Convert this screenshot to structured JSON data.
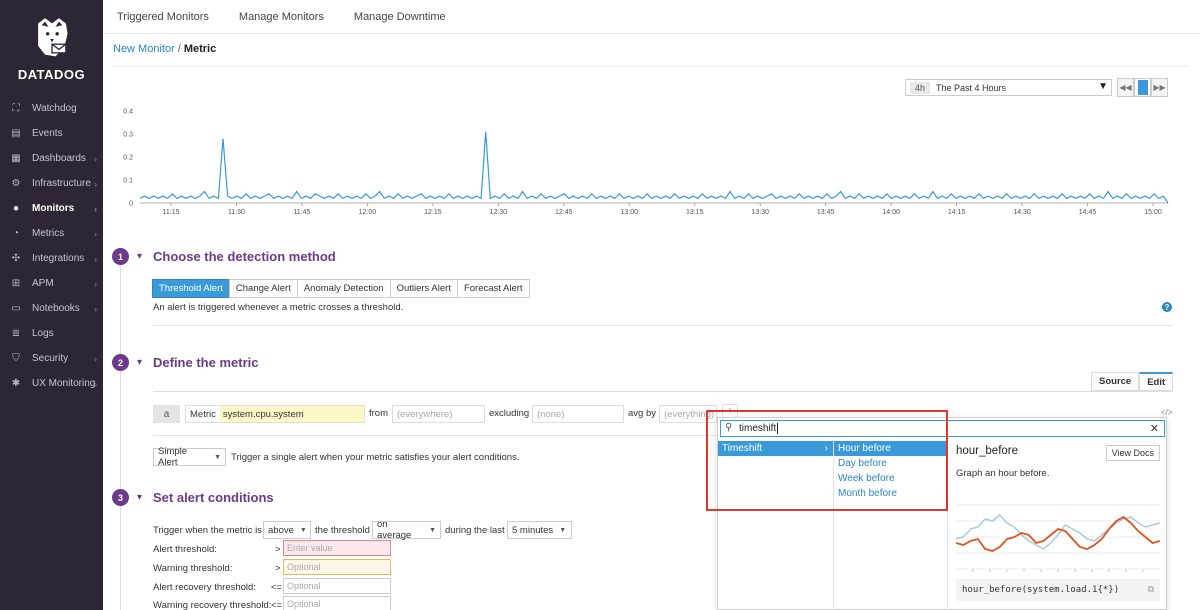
{
  "brand": {
    "name": "DATADOG",
    "accent": "#6b3a8b",
    "blue": "#3a9ad9"
  },
  "sidebar": {
    "items": [
      {
        "label": "Watchdog",
        "icon": "binoculars-icon",
        "glyph": "⛶",
        "chevron": false
      },
      {
        "label": "Events",
        "icon": "events-icon",
        "glyph": "▤",
        "chevron": false
      },
      {
        "label": "Dashboards",
        "icon": "dashboards-icon",
        "glyph": "▦",
        "chevron": true
      },
      {
        "label": "Infrastructure",
        "icon": "infrastructure-icon",
        "glyph": "⚙",
        "chevron": true
      },
      {
        "label": "Monitors",
        "icon": "monitors-icon",
        "glyph": "●",
        "chevron": true,
        "active": true
      },
      {
        "label": "Metrics",
        "icon": "metrics-icon",
        "glyph": "◔",
        "chevron": true
      },
      {
        "label": "Integrations",
        "icon": "integrations-icon",
        "glyph": "✣",
        "chevron": true
      },
      {
        "label": "APM",
        "icon": "apm-icon",
        "glyph": "⊞",
        "chevron": true
      },
      {
        "label": "Notebooks",
        "icon": "notebooks-icon",
        "glyph": "▭",
        "chevron": true
      },
      {
        "label": "Logs",
        "icon": "logs-icon",
        "glyph": "≣",
        "chevron": false
      },
      {
        "label": "Security",
        "icon": "shield-icon",
        "glyph": "⛉",
        "chevron": true
      },
      {
        "label": "UX Monitoring",
        "icon": "ux-monitoring-icon",
        "glyph": "✱",
        "chevron": true
      }
    ]
  },
  "topnav": {
    "tabs": [
      "Triggered Monitors",
      "Manage Monitors",
      "Manage Downtime"
    ]
  },
  "breadcrumb": {
    "parent": "New Monitor",
    "separator": "/",
    "current": "Metric"
  },
  "timepicker": {
    "badge": "4h",
    "label": "The Past 4 Hours"
  },
  "chart_data": {
    "type": "line",
    "yticks": [
      "0.4",
      "0.3",
      "0.2",
      "0.1",
      "0"
    ],
    "ylim": [
      0,
      0.4
    ],
    "xticks": [
      "11:15",
      "11:30",
      "11:45",
      "12:00",
      "12:15",
      "12:30",
      "12:45",
      "13:00",
      "13:15",
      "13:30",
      "13:45",
      "14:00",
      "14:15",
      "14:30",
      "14:45",
      "15:00"
    ],
    "color": "#3a9ad9",
    "values": [
      0.02,
      0.03,
      0.02,
      0.03,
      0.02,
      0.03,
      0.02,
      0.04,
      0.02,
      0.03,
      0.02,
      0.03,
      0.02,
      0.03,
      0.05,
      0.02,
      0.03,
      0.02,
      0.28,
      0.03,
      0.02,
      0.03,
      0.02,
      0.04,
      0.02,
      0.03,
      0.02,
      0.03,
      0.04,
      0.02,
      0.03,
      0.02,
      0.03,
      0.02,
      0.05,
      0.02,
      0.03,
      0.02,
      0.04,
      0.03,
      0.02,
      0.03,
      0.02,
      0.04,
      0.02,
      0.03,
      0.02,
      0.03,
      0.02,
      0.04,
      0.02,
      0.03,
      0.05,
      0.02,
      0.03,
      0.02,
      0.04,
      0.02,
      0.03,
      0.02,
      0.03,
      0.04,
      0.02,
      0.03,
      0.02,
      0.03,
      0.02,
      0.04,
      0.02,
      0.03,
      0.02,
      0.03,
      0.02,
      0.03,
      0.02,
      0.31,
      0.02,
      0.03,
      0.02,
      0.04,
      0.02,
      0.03,
      0.02,
      0.05,
      0.02,
      0.03,
      0.02,
      0.04,
      0.02,
      0.03,
      0.02,
      0.03,
      0.04,
      0.02,
      0.03,
      0.02,
      0.03,
      0.02,
      0.04,
      0.02,
      0.03,
      0.02,
      0.03,
      0.02,
      0.04,
      0.02,
      0.03,
      0.02,
      0.03,
      0.02,
      0.04,
      0.02,
      0.03,
      0.02,
      0.03,
      0.02,
      0.04,
      0.02,
      0.03,
      0.02,
      0.03,
      0.02,
      0.04,
      0.02,
      0.03,
      0.02,
      0.03,
      0.02,
      0.05,
      0.02,
      0.03,
      0.02,
      0.04,
      0.02,
      0.03,
      0.02,
      0.03,
      0.04,
      0.02,
      0.03,
      0.02,
      0.03,
      0.02,
      0.04,
      0.02,
      0.03,
      0.02,
      0.03,
      0.02,
      0.04,
      0.02,
      0.03,
      0.05,
      0.02,
      0.03,
      0.02,
      0.04,
      0.02,
      0.03,
      0.02,
      0.03,
      0.02,
      0.04,
      0.02,
      0.03,
      0.02,
      0.03,
      0.02,
      0.04,
      0.02,
      0.03,
      0.02,
      0.05,
      0.02,
      0.03,
      0.02,
      0.04,
      0.02,
      0.03,
      0.02,
      0.03,
      0.02,
      0.04,
      0.02,
      0.03,
      0.02,
      0.03,
      0.02,
      0.04,
      0.02,
      0.03,
      0.02,
      0.03,
      0.02,
      0.04,
      0.02,
      0.03,
      0.02,
      0.03,
      0.02,
      0.04,
      0.02,
      0.03,
      0.02,
      0.03,
      0.02,
      0.04,
      0.02,
      0.03,
      0.02,
      0.05,
      0.02,
      0.03,
      0.02,
      0.04,
      0.02,
      0.03,
      0.02,
      0.03,
      0.02,
      0.04,
      0.02,
      0.03,
      0.0
    ]
  },
  "step1": {
    "num": "1",
    "title": "Choose the detection method",
    "methods": [
      "Threshold Alert",
      "Change Alert",
      "Anomaly Detection",
      "Outliers Alert",
      "Forecast Alert"
    ],
    "description": "An alert is triggered whenever a metric crosses a threshold.",
    "help": "?"
  },
  "step2": {
    "num": "2",
    "title": "Define the metric",
    "tabs": [
      "Source",
      "Edit"
    ],
    "query": {
      "letter": "a",
      "metric_label": "Metric",
      "metric_value": "system.cpu.system",
      "from_label": "from",
      "from_placeholder": "(everywhere)",
      "excluding_label": "excluding",
      "excluding_placeholder": "(none)",
      "avgby_label": "avg by",
      "avgby_placeholder": "(everything)",
      "plus": "+",
      "code": "</>"
    },
    "alert_type": "Simple Alert",
    "alert_type_desc": "Trigger a single alert when your metric satisfies your alert conditions."
  },
  "step3": {
    "num": "3",
    "title": "Set alert conditions",
    "trigger_prefix": "Trigger when the metric is",
    "comparator": "above",
    "threshold_label": "the threshold",
    "aggregation": "on average",
    "during_label": "during the last",
    "window": "5 minutes",
    "rows": [
      {
        "label": "Alert threshold:",
        "op": ">",
        "placeholder": "Enter value",
        "kind": "alert"
      },
      {
        "label": "Warning threshold:",
        "op": ">",
        "placeholder": "Optional",
        "kind": "warn"
      },
      {
        "label": "Alert recovery threshold:",
        "op": "<=",
        "placeholder": "Optional",
        "kind": ""
      },
      {
        "label": "Warning recovery threshold:",
        "op": "<=",
        "placeholder": "Optional",
        "kind": ""
      }
    ]
  },
  "dropdown": {
    "search_value": "timeshift",
    "category": "Timeshift",
    "options": [
      "Hour before",
      "Day before",
      "Week before",
      "Month before"
    ],
    "selected_index": 0,
    "fn_name": "hour_before",
    "docs_label": "View Docs",
    "fn_desc": "Graph an hour before.",
    "example": "hour_before(system.load.1{*})",
    "preview_colors": [
      "#a6cbe3",
      "#e0541b"
    ]
  }
}
